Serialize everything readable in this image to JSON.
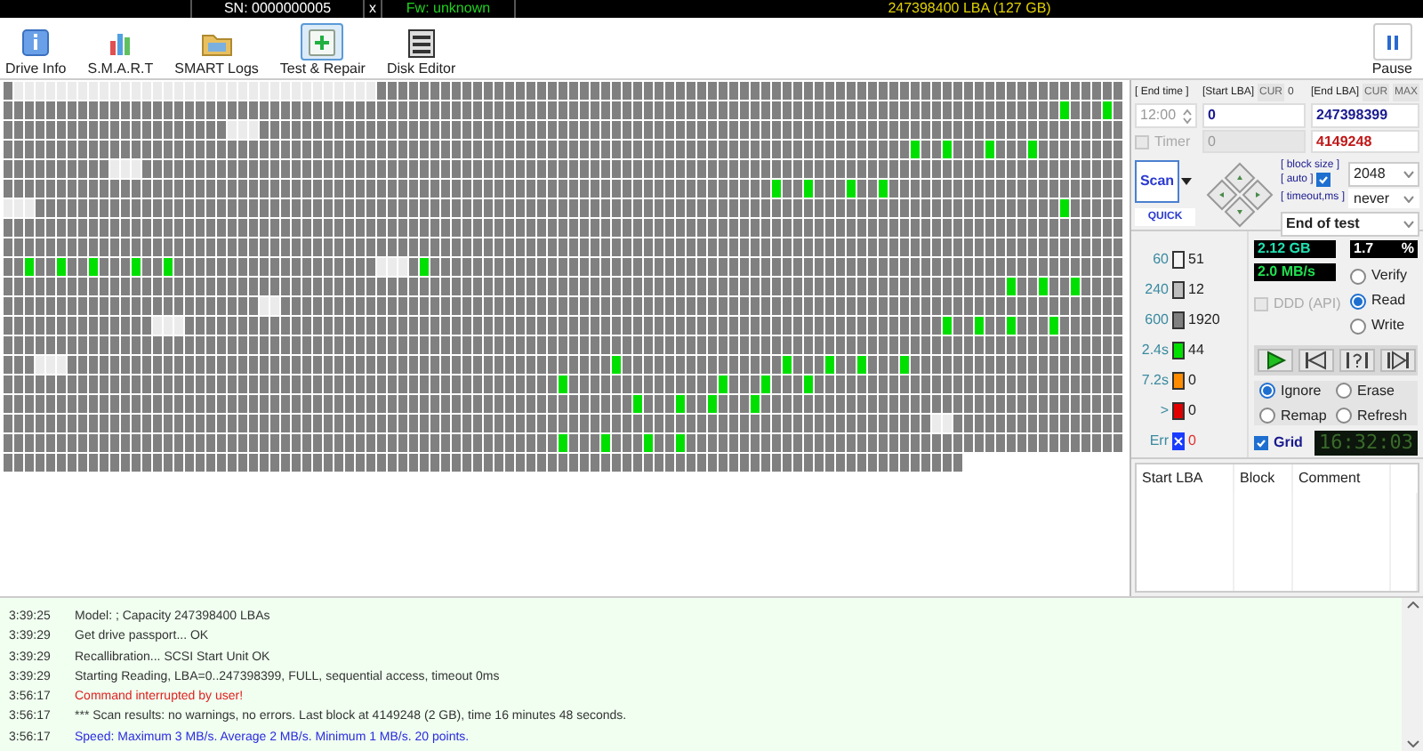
{
  "top_bar": {
    "serial": "SN: 0000000005",
    "close": "x",
    "firmware": "Fw: unknown",
    "capacity": "247398400 LBA (127 GB)"
  },
  "toolbar": {
    "buttons": [
      {
        "label": "Drive Info",
        "kind": "info",
        "selected": false
      },
      {
        "label": "S.M.A.R.T",
        "kind": "smart",
        "selected": false
      },
      {
        "label": "SMART Logs",
        "kind": "logs",
        "selected": false
      },
      {
        "label": "Test & Repair",
        "kind": "test",
        "selected": true
      },
      {
        "label": "Disk Editor",
        "kind": "editor",
        "selected": false
      }
    ],
    "pause": "Pause"
  },
  "scan_settings": {
    "end_time_label": "[ End time ]",
    "start_lba_label": "[Start LBA]",
    "start_cur": "CUR",
    "start_cur_value": "0",
    "end_lba_label": "[End LBA]",
    "end_cur": "CUR",
    "end_max": "MAX",
    "end_time": "12:00",
    "start_lba": "0",
    "end_lba": "247398399",
    "timer": {
      "label": "Timer",
      "checked": false,
      "disabled": true
    },
    "timer_value": "0",
    "current_lba": "4149248",
    "scan_button": "Scan",
    "quick_button": "QUICK",
    "block_size_label": "[ block size ]",
    "auto_label": "[ auto ]",
    "auto_checked": true,
    "block_size": "2048",
    "timeout_label": "[ timeout,ms ]",
    "timeout": "never",
    "end_action": "End of test"
  },
  "legend": [
    {
      "label": "60",
      "count": "51",
      "color": "#f4f4f4",
      "kind": "block"
    },
    {
      "label": "240",
      "count": "12",
      "color": "#bdbdbd",
      "kind": "block"
    },
    {
      "label": "600",
      "count": "1920",
      "color": "#808080",
      "kind": "block"
    },
    {
      "label": "2.4s",
      "count": "44",
      "color": "#00e000",
      "kind": "block"
    },
    {
      "label": "7.2s",
      "count": "0",
      "color": "#ff8c00",
      "kind": "block"
    },
    {
      "label": ">",
      "count": "0",
      "color": "#e00000",
      "kind": "block"
    },
    {
      "label": "Err",
      "count": "0",
      "color": "#1a3cff",
      "kind": "error"
    }
  ],
  "stats": {
    "processed": "2.12 GB",
    "percent": "1.7",
    "percent_unit": "%",
    "speed": "2.0 MB/s",
    "ddd": {
      "label": "DDD (API)",
      "checked": false,
      "disabled": true
    }
  },
  "modes": [
    {
      "label": "Verify",
      "selected": false
    },
    {
      "label": "Read",
      "selected": true
    },
    {
      "label": "Write",
      "selected": false
    }
  ],
  "transport": [
    {
      "kind": "play"
    },
    {
      "kind": "back"
    },
    {
      "kind": "skip"
    },
    {
      "kind": "end"
    }
  ],
  "actions": [
    {
      "label": "Ignore",
      "selected": true
    },
    {
      "label": "Erase",
      "selected": false
    },
    {
      "label": "Remap",
      "selected": false
    },
    {
      "label": "Refresh",
      "selected": false
    }
  ],
  "grid": {
    "label": "Grid",
    "checked": true
  },
  "clock": "16:32:03",
  "table": {
    "columns": [
      "Start LBA",
      "Block",
      "Comment"
    ]
  },
  "log": [
    {
      "time": "3:39:25",
      "text": "Model:  ; Capacity 247398400 LBAs",
      "kind": "normal"
    },
    {
      "time": "3:39:29",
      "text": "Get drive passport... OK",
      "kind": "normal"
    },
    {
      "time": "3:39:29",
      "text": "Recallibration... SCSI  Start Unit OK",
      "kind": "normal"
    },
    {
      "time": "3:39:29",
      "text": "Starting Reading, LBA=0..247398399, FULL, sequential access, timeout 0ms",
      "kind": "normal"
    },
    {
      "time": "3:56:17",
      "text": "Command interrupted by user!",
      "kind": "error"
    },
    {
      "time": "3:56:17",
      "text": "*** Scan results: no warnings, no errors. Last block at 4149248 (2 GB), time 16 minutes 48 seconds.",
      "kind": "normal"
    },
    {
      "time": "3:56:17",
      "text": "Speed: Maximum 3 MB/s. Average 2 MB/s. Minimum 1 MB/s. 20 points.",
      "kind": "info"
    }
  ]
}
